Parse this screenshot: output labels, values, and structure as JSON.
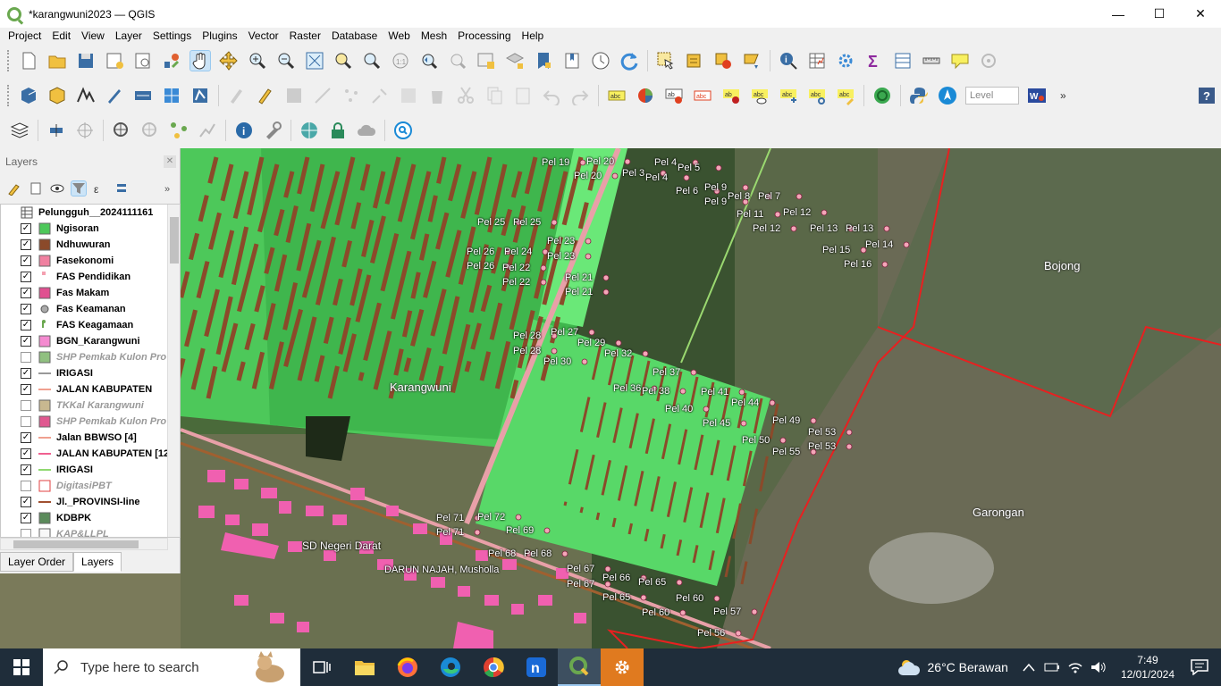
{
  "window": {
    "title": "*karangwuni2023 — QGIS",
    "minimize": "—",
    "maximize": "☐",
    "close": "✕"
  },
  "menu": [
    "Project",
    "Edit",
    "View",
    "Layer",
    "Settings",
    "Plugins",
    "Vector",
    "Raster",
    "Database",
    "Web",
    "Mesh",
    "Processing",
    "Help"
  ],
  "toolbar": {
    "level_placeholder": "Level"
  },
  "layers_panel": {
    "title": "Layers",
    "close": "✕",
    "layers": [
      {
        "name": "Pelungguh__2024111161",
        "checked": "",
        "symbol": "table-icon",
        "visible": true
      },
      {
        "name": "Ngisoran",
        "checked": "✓",
        "symbol": "fill-green",
        "visible": true
      },
      {
        "name": "Ndhuwuran",
        "checked": "✓",
        "symbol": "fill-brown",
        "visible": true
      },
      {
        "name": "Fasekonomi",
        "checked": "✓",
        "symbol": "fill-pink",
        "visible": true
      },
      {
        "name": "FAS Pendidikan",
        "checked": "✓",
        "symbol": "point-pink",
        "visible": true
      },
      {
        "name": "Fas Makam",
        "checked": "✓",
        "symbol": "fill-magenta",
        "visible": true
      },
      {
        "name": "Fas Keamanan",
        "checked": "✓",
        "symbol": "point-grey",
        "visible": true
      },
      {
        "name": "FAS Keagamaan",
        "checked": "✓",
        "symbol": "point-green",
        "visible": true
      },
      {
        "name": "BGN_Karangwuni",
        "checked": "✓",
        "symbol": "fill-lightpink",
        "visible": true
      },
      {
        "name": "SHP Pemkab Kulon Pro",
        "checked": "",
        "symbol": "fill-sage",
        "visible": false
      },
      {
        "name": "IRIGASI",
        "checked": "✓",
        "symbol": "line-grey",
        "visible": true
      },
      {
        "name": "JALAN KABUPATEN",
        "checked": "✓",
        "symbol": "line-salmon",
        "visible": true
      },
      {
        "name": "TKKal Karangwuni",
        "checked": "",
        "symbol": "fill-tan",
        "visible": false
      },
      {
        "name": "SHP Pemkab Kulon Pro",
        "checked": "",
        "symbol": "fill-rose",
        "visible": false
      },
      {
        "name": "Jalan BBWSO [4]",
        "checked": "✓",
        "symbol": "line-salmon",
        "visible": true
      },
      {
        "name": "JALAN KABUPATEN [12",
        "checked": "✓",
        "symbol": "line-pink",
        "visible": true
      },
      {
        "name": "IRIGASI",
        "checked": "✓",
        "symbol": "line-lightgreen",
        "visible": true
      },
      {
        "name": "DigitasiPBT",
        "checked": "",
        "symbol": "fill-outline-red",
        "visible": false
      },
      {
        "name": "Jl._PROVINSI-line",
        "checked": "✓",
        "symbol": "line-brown",
        "visible": true
      },
      {
        "name": "KDBPK",
        "checked": "✓",
        "symbol": "fill-darkgreen",
        "visible": true
      },
      {
        "name": "KAP&LLPL",
        "checked": "",
        "symbol": "fill-white",
        "visible": false
      }
    ],
    "tabs": [
      "Layer Order",
      "Layers"
    ]
  },
  "map": {
    "places": [
      "Karangwuni",
      "Bojong",
      "Garongan"
    ],
    "pois": [
      "SD Negeri Darat",
      "DARUN NAJAH, Musholla"
    ],
    "pel_labels": [
      "Pel 19",
      "Pel 20",
      "Pel 20",
      "Pel 3",
      "Pel 4",
      "Pel 4",
      "Pel 5",
      "Pel 6",
      "Pel 9",
      "Pel 9",
      "Pel 8",
      "Pel 7",
      "Pel 11",
      "Pel 12",
      "Pel 12",
      "Pel 13",
      "Pel 13",
      "Pel 14",
      "Pel 15",
      "Pel 16",
      "Pel 25",
      "Pel 25",
      "Pel 23",
      "Pel 26",
      "Pel 24",
      "Pel 23",
      "Pel 26",
      "Pel 22",
      "Pel 22",
      "Pel 21",
      "Pel 21",
      "Pel 28",
      "Pel 27",
      "Pel 28",
      "Pel 29",
      "Pel 30",
      "Pel 32",
      "Pel 37",
      "Pel 36",
      "Pel 38",
      "Pel 41",
      "Pel 40",
      "Pel 44",
      "Pel 45",
      "Pel 49",
      "Pel 50",
      "Pel 53",
      "Pel 55",
      "Pel 53",
      "Pel 71",
      "Pel 72",
      "Pel 71",
      "Pel 69",
      "Pel 68",
      "Pel 68",
      "Pel 67",
      "Pel 67",
      "Pel 66",
      "Pel 65",
      "Pel 65",
      "Pel 60",
      "Pel 60",
      "Pel 57",
      "Pel 56"
    ]
  },
  "taskbar": {
    "search_placeholder": "Type here to search",
    "weather": "26°C  Berawan",
    "time": "7:49",
    "date": "12/01/2024"
  }
}
